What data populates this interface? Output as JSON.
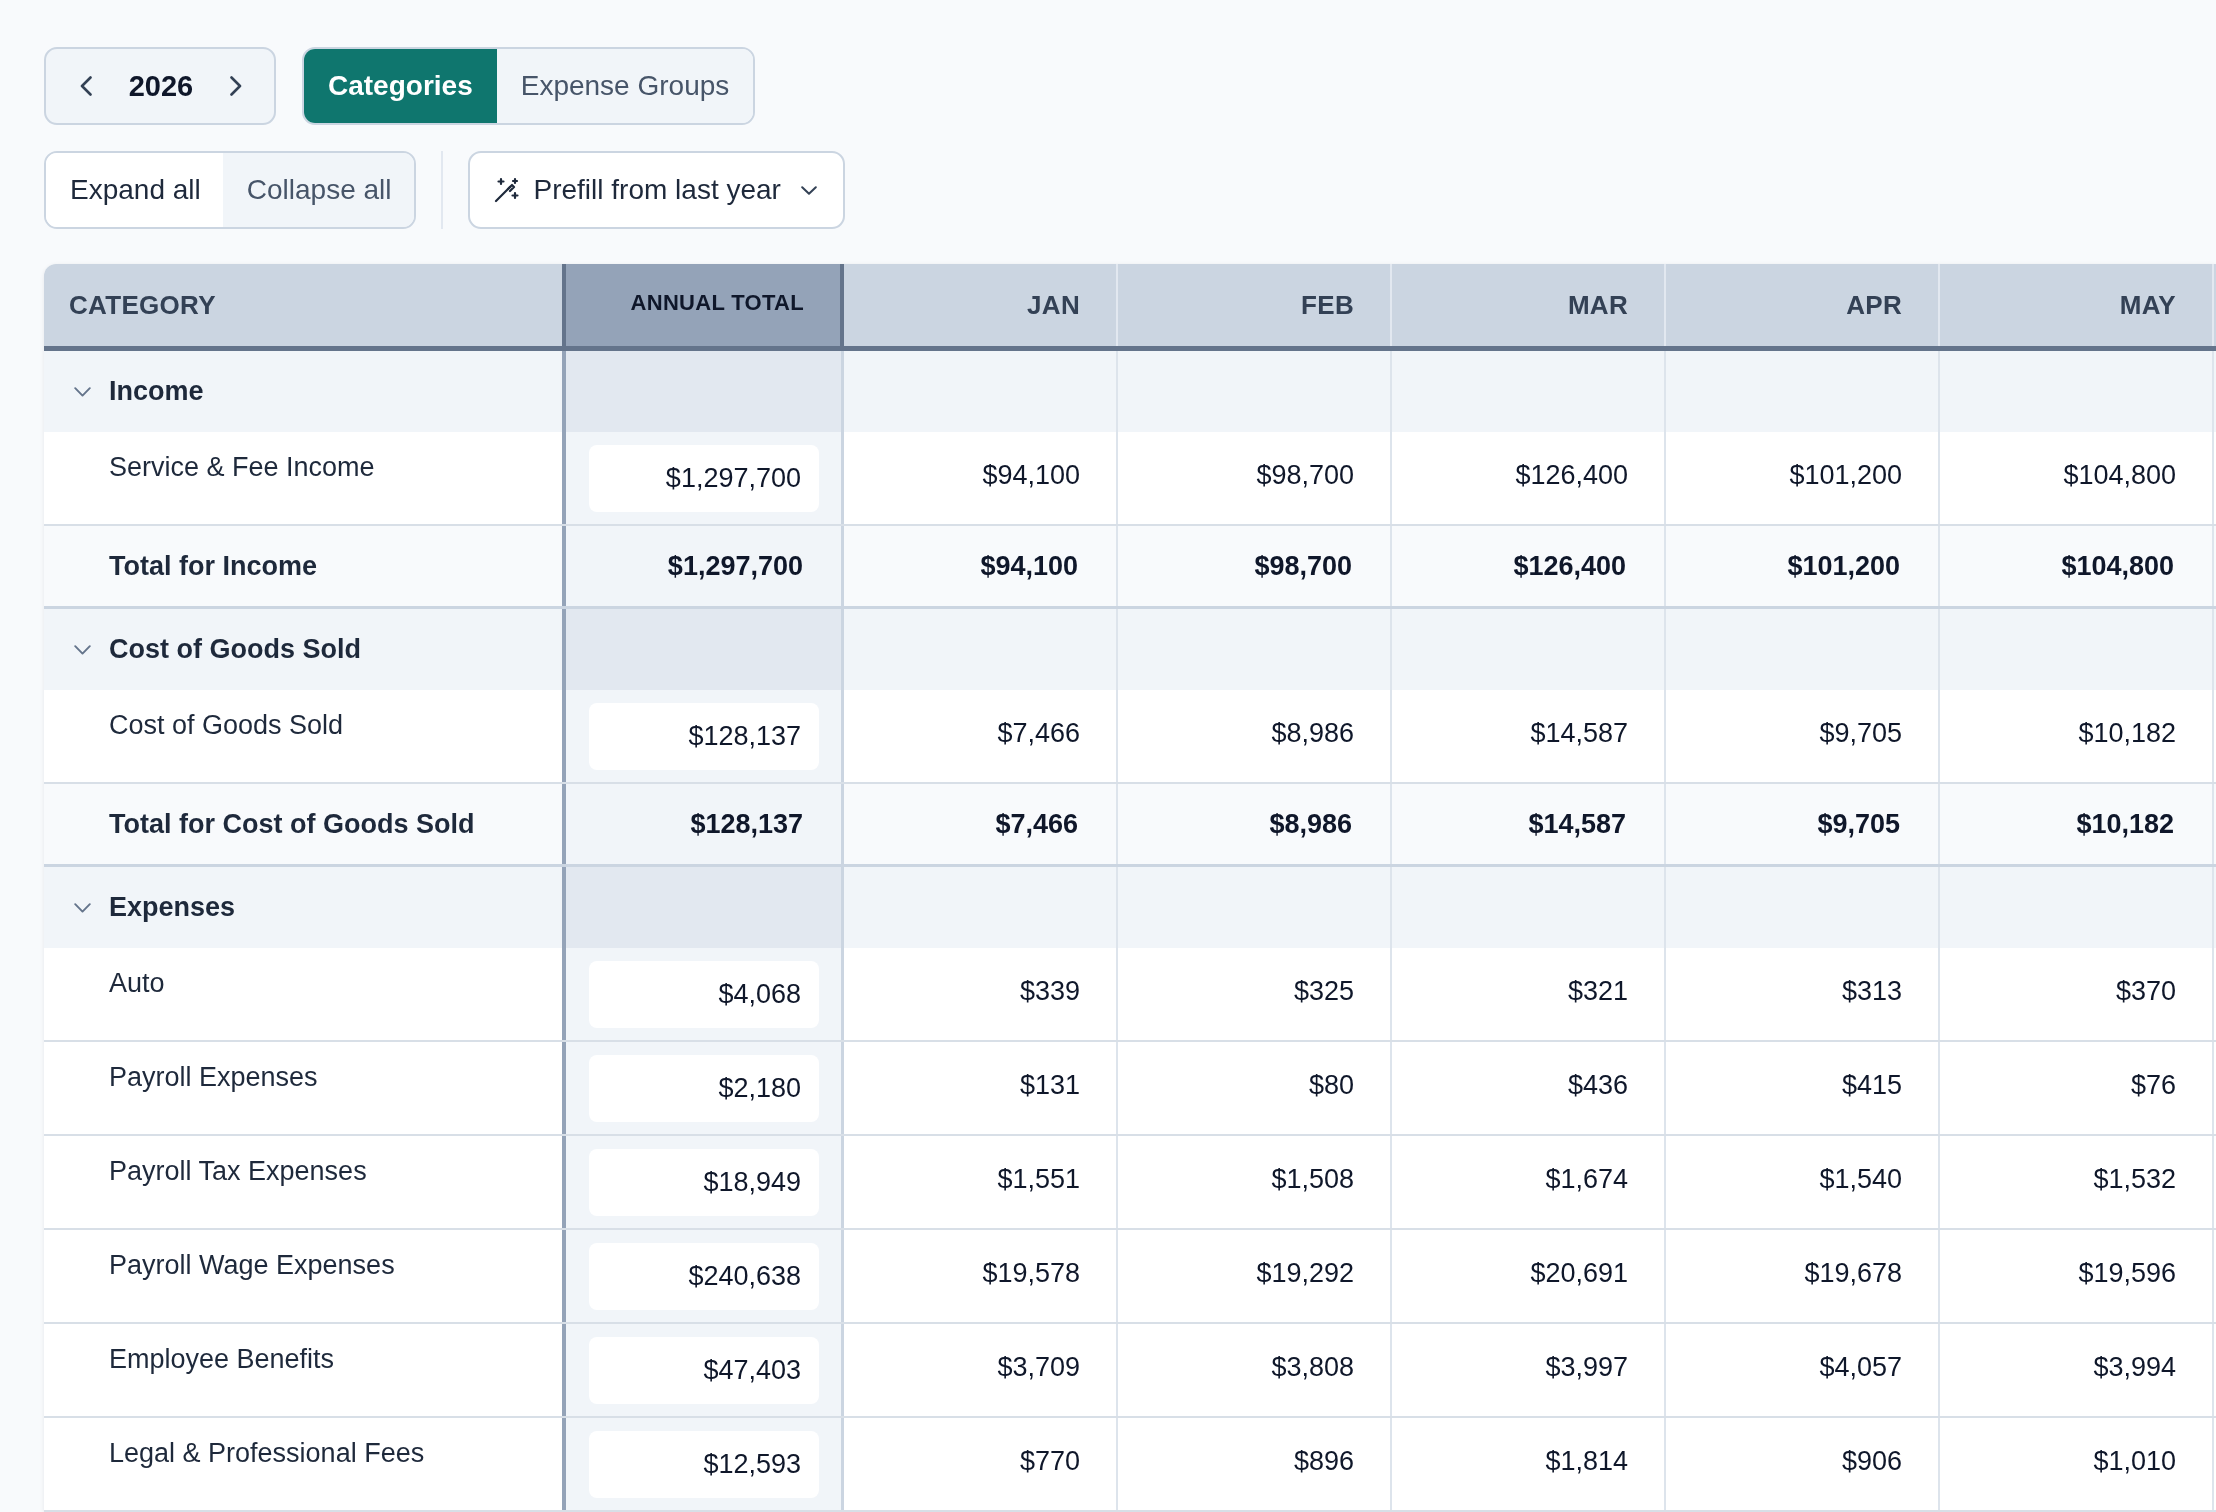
{
  "toolbar": {
    "year_picker": {
      "year": "2026"
    },
    "view_tabs": [
      {
        "label": "Categories",
        "selected": true
      },
      {
        "label": "Expense Groups",
        "selected": false
      }
    ],
    "expand_controls": [
      {
        "label": "Expand all",
        "selected": true
      },
      {
        "label": "Collapse all",
        "selected": false
      }
    ],
    "prefill_button": {
      "label": "Prefill from last year"
    }
  },
  "table": {
    "columns": [
      {
        "label": "CATEGORY",
        "kind": "category"
      },
      {
        "label": "ANNUAL TOTAL",
        "kind": "annual"
      },
      {
        "label": "JAN",
        "kind": "month"
      },
      {
        "label": "FEB",
        "kind": "month"
      },
      {
        "label": "MAR",
        "kind": "month"
      },
      {
        "label": "APR",
        "kind": "month"
      },
      {
        "label": "MAY",
        "kind": "month"
      }
    ],
    "groups": [
      {
        "label": "Income",
        "expanded": true,
        "children": [
          {
            "label": "Service & Fee Income",
            "annual_total": "$1,297,700",
            "months": [
              "$94,100",
              "$98,700",
              "$126,400",
              "$101,200",
              "$104,800"
            ]
          }
        ],
        "total": {
          "label": "Total for Income",
          "annual_total": "$1,297,700",
          "months": [
            "$94,100",
            "$98,700",
            "$126,400",
            "$101,200",
            "$104,800"
          ]
        }
      },
      {
        "label": "Cost of Goods Sold",
        "expanded": true,
        "children": [
          {
            "label": "Cost of Goods Sold",
            "annual_total": "$128,137",
            "months": [
              "$7,466",
              "$8,986",
              "$14,587",
              "$9,705",
              "$10,182"
            ]
          }
        ],
        "total": {
          "label": "Total for Cost of Goods Sold",
          "annual_total": "$128,137",
          "months": [
            "$7,466",
            "$8,986",
            "$14,587",
            "$9,705",
            "$10,182"
          ]
        }
      },
      {
        "label": "Expenses",
        "expanded": true,
        "children": [
          {
            "label": "Auto",
            "annual_total": "$4,068",
            "months": [
              "$339",
              "$325",
              "$321",
              "$313",
              "$370"
            ]
          },
          {
            "label": "Payroll Expenses",
            "annual_total": "$2,180",
            "months": [
              "$131",
              "$80",
              "$436",
              "$415",
              "$76"
            ]
          },
          {
            "label": "Payroll Tax Expenses",
            "annual_total": "$18,949",
            "months": [
              "$1,551",
              "$1,508",
              "$1,674",
              "$1,540",
              "$1,532"
            ]
          },
          {
            "label": "Payroll Wage Expenses",
            "annual_total": "$240,638",
            "months": [
              "$19,578",
              "$19,292",
              "$20,691",
              "$19,678",
              "$19,596"
            ]
          },
          {
            "label": "Employee Benefits",
            "annual_total": "$47,403",
            "months": [
              "$3,709",
              "$3,808",
              "$3,997",
              "$4,057",
              "$3,994"
            ]
          },
          {
            "label": "Legal & Professional Fees",
            "annual_total": "$12,593",
            "months": [
              "$770",
              "$896",
              "$1,814",
              "$906",
              "$1,010"
            ]
          }
        ]
      }
    ]
  }
}
